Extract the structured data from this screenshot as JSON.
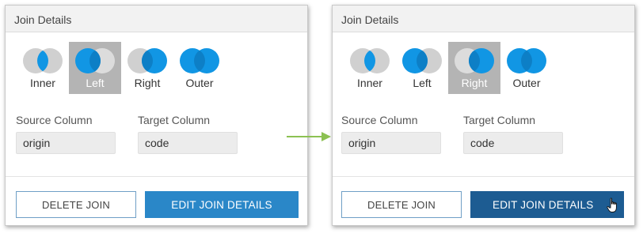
{
  "colors": {
    "venn_blue": "#1196e4",
    "venn_gray": "#d0d0d0",
    "selected_bg": "#b4b4b4",
    "edit_button": "#2a87c8",
    "edit_button_hover": "#1d5c92",
    "arrow": "#8cc152"
  },
  "panels": [
    {
      "title": "Join Details",
      "join_types": [
        {
          "label": "Inner",
          "icon": "venn-inner-icon",
          "selected": false
        },
        {
          "label": "Left",
          "icon": "venn-left-icon",
          "selected": true
        },
        {
          "label": "Right",
          "icon": "venn-right-icon",
          "selected": false
        },
        {
          "label": "Outer",
          "icon": "venn-outer-icon",
          "selected": false
        }
      ],
      "source_column": {
        "label": "Source Column",
        "value": "origin"
      },
      "target_column": {
        "label": "Target Column",
        "value": "code"
      },
      "delete_button": "DELETE JOIN",
      "edit_button": "EDIT JOIN DETAILS",
      "edit_state": "normal"
    },
    {
      "title": "Join Details",
      "join_types": [
        {
          "label": "Inner",
          "icon": "venn-inner-icon",
          "selected": false
        },
        {
          "label": "Left",
          "icon": "venn-left-icon",
          "selected": false
        },
        {
          "label": "Right",
          "icon": "venn-right-icon",
          "selected": true
        },
        {
          "label": "Outer",
          "icon": "venn-outer-icon",
          "selected": false
        }
      ],
      "source_column": {
        "label": "Source Column",
        "value": "origin"
      },
      "target_column": {
        "label": "Target Column",
        "value": "code"
      },
      "delete_button": "DELETE JOIN",
      "edit_button": "EDIT JOIN DETAILS",
      "edit_state": "hover"
    }
  ],
  "annotations": {
    "arrow_icon": "arrow-right-icon",
    "cursor_icon": "hand-pointer-icon"
  }
}
